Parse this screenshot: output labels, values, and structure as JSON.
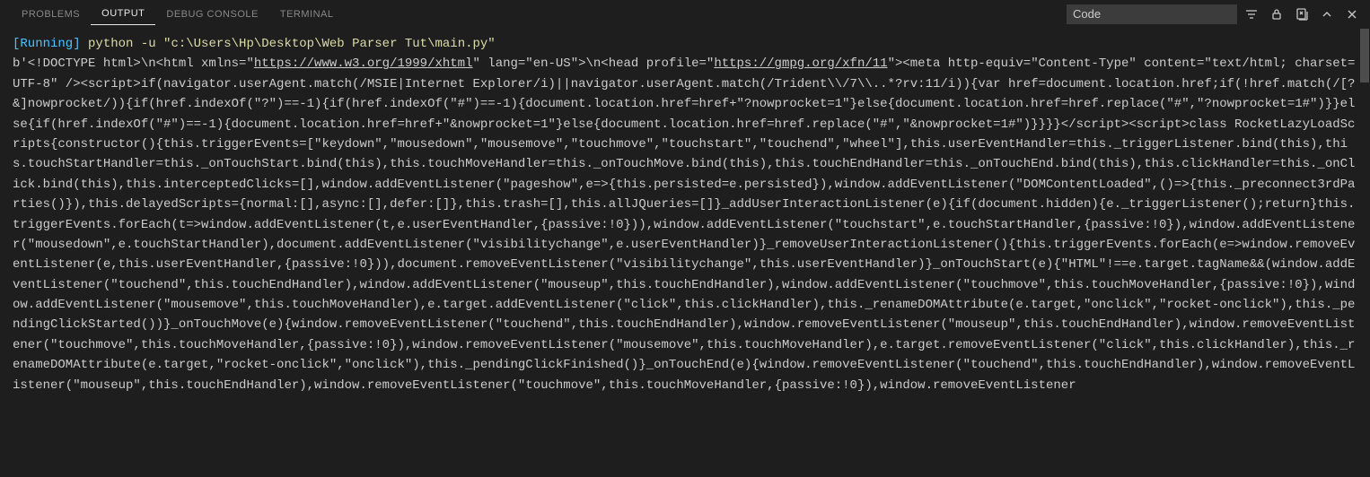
{
  "tabs": {
    "problems": "PROBLEMS",
    "output": "OUTPUT",
    "debug_console": "DEBUG CONSOLE",
    "terminal": "TERMINAL"
  },
  "dropdown": {
    "selected": "Code"
  },
  "output_run": {
    "status": "[Running]",
    "command": " python -u \"c:\\Users\\Hp\\Desktop\\Web Parser Tut\\main.py\""
  },
  "body": {
    "pre1": "b'<!DOCTYPE html>\\n<html xmlns=\"",
    "link1": "https://www.w3.org/1999/xhtml",
    "mid1": "\" lang=\"en-US\">\\n<head profile=\"",
    "link2": "https://gmpg.org/xfn/11",
    "post1": "\"><meta http-equiv=\"Content-Type\" content=\"text/html; charset=UTF-8\" /><script>if(navigator.userAgent.match(/MSIE|Internet Explorer/i)||navigator.userAgent.match(/Trident\\\\/7\\\\..*?rv:11/i)){var href=document.location.href;if(!href.match(/[?&]nowprocket/)){if(href.indexOf(\"?\")==-1){if(href.indexOf(\"#\")==-1){document.location.href=href+\"?nowprocket=1\"}else{document.location.href=href.replace(\"#\",\"?nowprocket=1#\")}}else{if(href.indexOf(\"#\")==-1){document.location.href=href+\"&nowprocket=1\"}else{document.location.href=href.replace(\"#\",\"&nowprocket=1#\")}}}}</script><script>class RocketLazyLoadScripts{constructor(){this.triggerEvents=[\"keydown\",\"mousedown\",\"mousemove\",\"touchmove\",\"touchstart\",\"touchend\",\"wheel\"],this.userEventHandler=this._triggerListener.bind(this),this.touchStartHandler=this._onTouchStart.bind(this),this.touchMoveHandler=this._onTouchMove.bind(this),this.touchEndHandler=this._onTouchEnd.bind(this),this.clickHandler=this._onClick.bind(this),this.interceptedClicks=[],window.addEventListener(\"pageshow\",e=>{this.persisted=e.persisted}),window.addEventListener(\"DOMContentLoaded\",()=>{this._preconnect3rdParties()}),this.delayedScripts={normal:[],async:[],defer:[]},this.trash=[],this.allJQueries=[]}_addUserInteractionListener(e){if(document.hidden){e._triggerListener();return}this.triggerEvents.forEach(t=>window.addEventListener(t,e.userEventHandler,{passive:!0})),window.addEventListener(\"touchstart\",e.touchStartHandler,{passive:!0}),window.addEventListener(\"mousedown\",e.touchStartHandler),document.addEventListener(\"visibilitychange\",e.userEventHandler)}_removeUserInteractionListener(){this.triggerEvents.forEach(e=>window.removeEventListener(e,this.userEventHandler,{passive:!0})),document.removeEventListener(\"visibilitychange\",this.userEventHandler)}_onTouchStart(e){\"HTML\"!==e.target.tagName&&(window.addEventListener(\"touchend\",this.touchEndHandler),window.addEventListener(\"mouseup\",this.touchEndHandler),window.addEventListener(\"touchmove\",this.touchMoveHandler,{passive:!0}),window.addEventListener(\"mousemove\",this.touchMoveHandler),e.target.addEventListener(\"click\",this.clickHandler),this._renameDOMAttribute(e.target,\"onclick\",\"rocket-onclick\"),this._pendingClickStarted())}_onTouchMove(e){window.removeEventListener(\"touchend\",this.touchEndHandler),window.removeEventListener(\"mouseup\",this.touchEndHandler),window.removeEventListener(\"touchmove\",this.touchMoveHandler,{passive:!0}),window.removeEventListener(\"mousemove\",this.touchMoveHandler),e.target.removeEventListener(\"click\",this.clickHandler),this._renameDOMAttribute(e.target,\"rocket-onclick\",\"onclick\"),this._pendingClickFinished()}_onTouchEnd(e){window.removeEventListener(\"touchend\",this.touchEndHandler),window.removeEventListener(\"mouseup\",this.touchEndHandler),window.removeEventListener(\"touchmove\",this.touchMoveHandler,{passive:!0}),window.removeEventListener"
  }
}
